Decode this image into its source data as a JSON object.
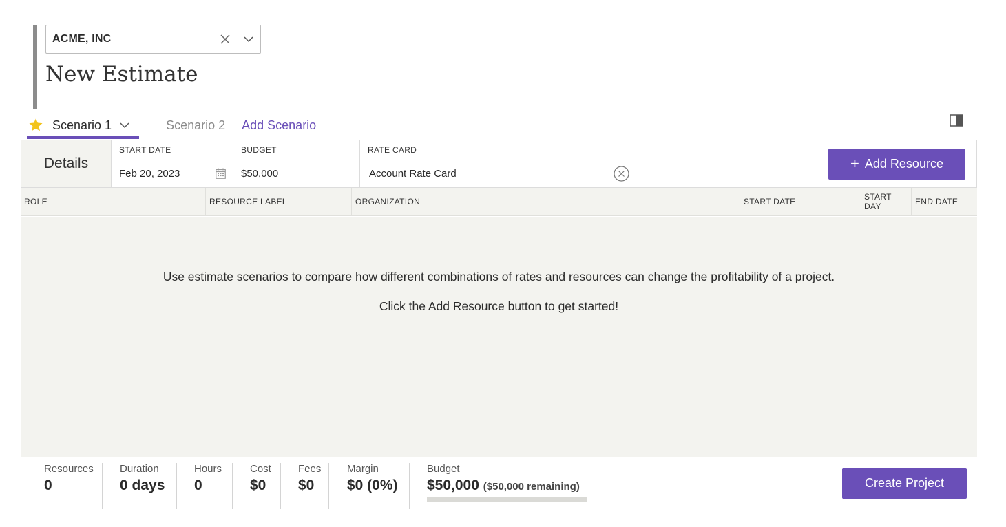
{
  "client": {
    "selected": "ACME, INC"
  },
  "page": {
    "title": "New Estimate"
  },
  "tabs": {
    "scenario_1": "Scenario 1",
    "scenario_2": "Scenario 2",
    "add_scenario": "Add Scenario"
  },
  "details": {
    "label": "Details",
    "start_date_label": "START DATE",
    "start_date_value": "Feb 20, 2023",
    "budget_label": "BUDGET",
    "budget_value": "$50,000",
    "rate_card_label": "RATE CARD",
    "rate_card_value": "Account Rate Card",
    "add_resource_label": "Add Resource"
  },
  "grid": {
    "columns": [
      "ROLE",
      "RESOURCE LABEL",
      "ORGANIZATION",
      "START DATE",
      "START DAY",
      "END DATE"
    ]
  },
  "empty_state": {
    "line1": "Use estimate scenarios to compare how different combinations of rates and resources can change the profitability of a project.",
    "line2": "Click the Add Resource button to get started!"
  },
  "summary": {
    "resources_label": "Resources",
    "resources_value": "0",
    "duration_label": "Duration",
    "duration_value": "0 days",
    "hours_label": "Hours",
    "hours_value": "0",
    "cost_label": "Cost",
    "cost_value": "$0",
    "fees_label": "Fees",
    "fees_value": "$0",
    "margin_label": "Margin",
    "margin_value": "$0 (0%)",
    "budget_label": "Budget",
    "budget_value": "$50,000",
    "budget_remaining": "($50,000 remaining)",
    "budget_used_fraction": 0
  },
  "actions": {
    "create_project": "Create Project"
  },
  "colors": {
    "accent": "#6a4fb8",
    "star": "#f2c31b",
    "panel_bg": "#f3f3ef"
  },
  "icons": {
    "clear": "close-icon",
    "dropdown": "chevron-down-icon",
    "favorite": "star-icon",
    "calendar": "calendar-icon",
    "panel": "panel-toggle-icon"
  }
}
